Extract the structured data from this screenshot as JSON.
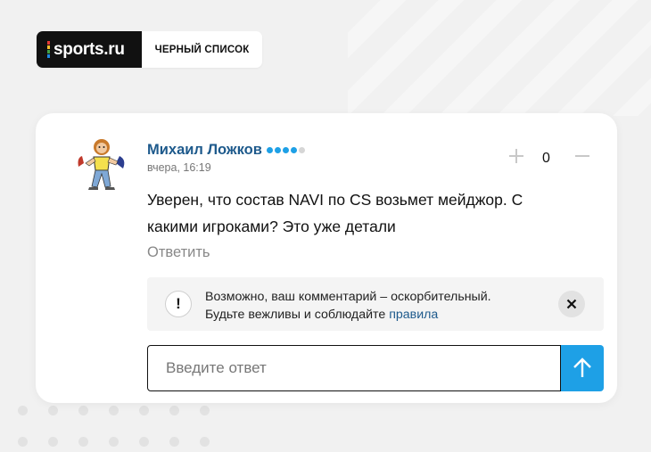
{
  "brand": {
    "logo_text": "sports.ru",
    "tag": "ЧЕРНЫЙ СПИСОК",
    "logo_bar_colors": [
      "#e53935",
      "#fbc02d",
      "#43a047",
      "#1e88e5"
    ]
  },
  "comment": {
    "author": "Михаил Ложков",
    "rating_dots": {
      "filled": 4,
      "total": 5,
      "filled_color": "#1ea0e6",
      "empty_color": "#d6d6d6"
    },
    "timestamp": "вчера, 16:19",
    "votes": "0",
    "text": "Уверен, что состав NAVI по CS возьмет мейджор. С какими игроками? Это уже детали",
    "reply_label": "Ответить",
    "avatar_icon": "cartoon-character-avatar"
  },
  "warning": {
    "icon": "exclamation-icon",
    "line1": "Возможно, ваш комментарий – оскорбительный.",
    "line2_prefix": "Будьте вежливы и соблюдайте ",
    "rules_link": "правила",
    "close_icon": "close-icon"
  },
  "reply_form": {
    "placeholder": "Введите ответ",
    "send_icon": "arrow-up-icon",
    "accent_color": "#1ea0e6"
  },
  "colors": {
    "author_link": "#1e5a8c",
    "page_background": "#f1f1f1"
  }
}
